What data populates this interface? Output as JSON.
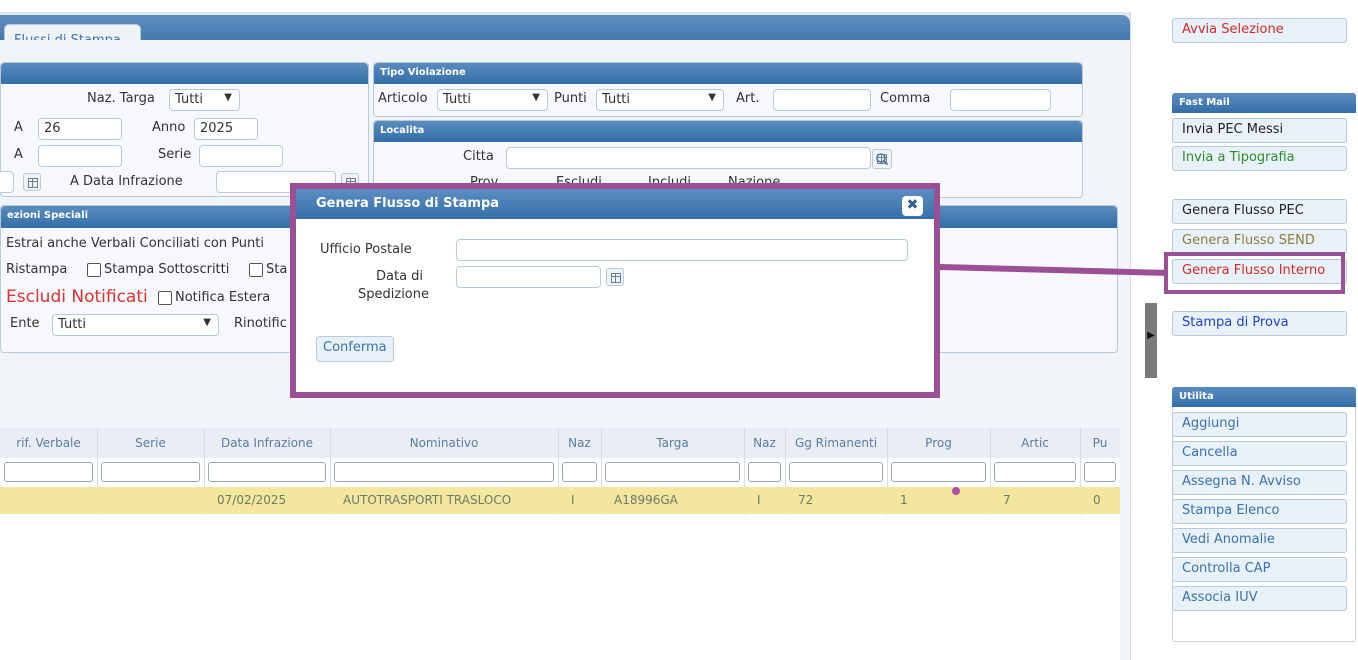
{
  "tab": {
    "label": "Flussi di Stampa"
  },
  "filters": {
    "naz_targa_label": "Naz. Targa",
    "naz_targa_value": "Tutti",
    "a_label_1": "A",
    "a_value_1": "26",
    "anno_label": "Anno",
    "anno_value": "2025",
    "a_label_2": "A",
    "a_value_2": "",
    "serie_label": "Serie",
    "serie_value": "",
    "a_data_infrazione_label": "A Data Infrazione",
    "a_data_infrazione_value": ""
  },
  "tipo_violazione": {
    "header": "Tipo Violazione",
    "articolo_label": "Articolo",
    "articolo_value": "Tutti",
    "punti_label": "Punti",
    "punti_value": "Tutti",
    "art_label": "Art.",
    "art_value": "",
    "comma_label": "Comma",
    "comma_value": ""
  },
  "localita": {
    "header": "Localita",
    "citta_label": "Citta",
    "citta_value": "",
    "prov_label": "Prov.",
    "escludi_label": "Escludi",
    "includi_label": "Includi",
    "nazione_label": "Nazione"
  },
  "selezioni_speciali": {
    "header": "ezioni Speciali",
    "estrai_label": "Estrai anche Verbali Conciliati con Punti",
    "ristampa_label": "Ristampa",
    "stampa_sottoscritti_label": "Stampa Sottoscritti",
    "sta_label": "Sta",
    "escludi_notificati_label": "Escludi Notificati",
    "notifica_estera_label": "Notifica Estera",
    "ente_label": "Ente",
    "ente_value": "Tutti",
    "rinotific_label": "Rinotific"
  },
  "grid": {
    "columns": [
      "rif. Verbale",
      "Serie",
      "Data Infrazione",
      "Nominativo",
      "Naz",
      "Targa",
      "Naz",
      "Gg Rimanenti",
      "Prog",
      "Artic",
      "Pu"
    ],
    "rows": [
      [
        "",
        "",
        "07/02/2025",
        "AUTOTRASPORTI TRASLOCO",
        "I",
        "A18996GA",
        "I",
        "72",
        "1",
        "7",
        "0"
      ]
    ]
  },
  "modal": {
    "title": "Genera Flusso di Stampa",
    "close_glyph": "✖",
    "ufficio_postale_label": "Ufficio Postale",
    "ufficio_postale_value": "",
    "data_spedizione_label_1": "Data di",
    "data_spedizione_label_2": "Spedizione",
    "data_spedizione_value": "",
    "confirm_label": "Conferma"
  },
  "sidebar": {
    "avvia_selezione": "Avvia Selezione",
    "fast_mail_header": "Fast Mail",
    "invia_pec_messi": "Invia PEC Messi",
    "invia_tipografia": "Invia a Tipografia",
    "genera_flusso_pec": "Genera Flusso PEC",
    "genera_flusso_send": "Genera Flusso SEND",
    "genera_flusso_interno": "Genera Flusso Interno",
    "stampa_di_prova": "Stampa di Prova",
    "utilita_header": "Utilita",
    "utilita_items": [
      "Aggiungi",
      "Cancella",
      "Assegna N. Avviso",
      "Stampa Elenco",
      "Vedi Anomalie",
      "Controlla CAP",
      "Associa IUV"
    ]
  },
  "colors": {
    "header_blue": "#336ea9",
    "highlight_row": "#f3e69e",
    "annotation_purple": "#9b4f96",
    "red_action": "#d42a2a",
    "green_action": "#2e8b2e",
    "olive_action": "#8a7d3b",
    "blue_action": "#1f44c9"
  },
  "icons": {
    "search": "search-icon",
    "calendar": "calendar-icon",
    "close": "close-icon",
    "expand": "expand-arrow-icon",
    "dropdown": "chevron-down-icon"
  }
}
